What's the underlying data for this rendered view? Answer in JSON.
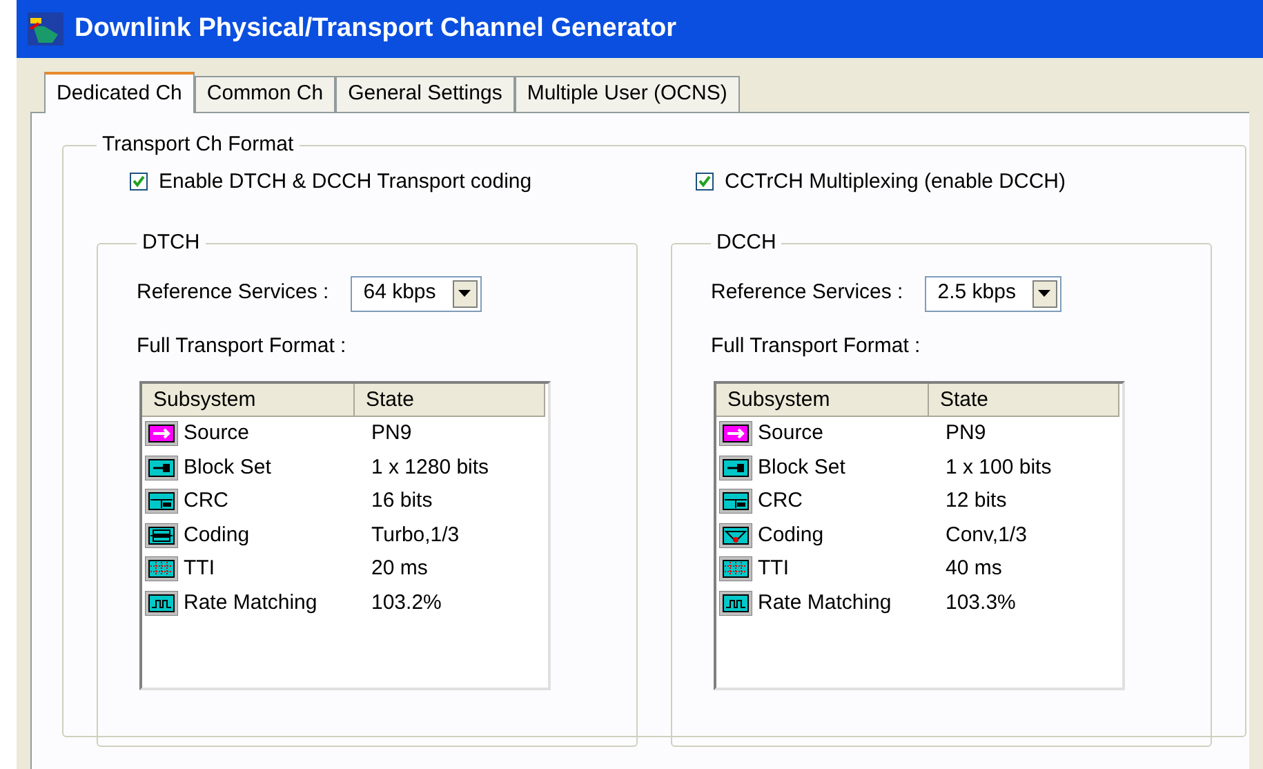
{
  "window": {
    "title": "Downlink Physical/Transport Channel Generator"
  },
  "tabs": [
    {
      "label": "Dedicated Ch",
      "selected": true
    },
    {
      "label": "Common Ch",
      "selected": false
    },
    {
      "label": "General Settings",
      "selected": false
    },
    {
      "label": "Multiple User (OCNS)",
      "selected": false
    }
  ],
  "transport_ch_format": {
    "title": "Transport Ch Format",
    "checkboxes": [
      {
        "label": "Enable DTCH & DCCH Transport coding",
        "checked": true
      },
      {
        "label": "CCTrCH Multiplexing (enable DCCH)",
        "checked": true
      }
    ],
    "groups": [
      {
        "title": "DTCH",
        "reference_label": "Reference Services :",
        "reference_value": "64 kbps",
        "format_label": "Full Transport Format :",
        "columns": [
          "Subsystem",
          "State"
        ],
        "rows": [
          {
            "kind": "source",
            "subsystem": "Source",
            "state": "PN9"
          },
          {
            "kind": "blockset",
            "subsystem": "Block Set",
            "state": "1 x 1280 bits"
          },
          {
            "kind": "crc",
            "subsystem": "CRC",
            "state": "16 bits"
          },
          {
            "kind": "turbo",
            "subsystem": "Coding",
            "state": "Turbo,1/3"
          },
          {
            "kind": "tti",
            "subsystem": "TTI",
            "state": "20 ms"
          },
          {
            "kind": "ratematch",
            "subsystem": "Rate Matching",
            "state": "103.2%"
          }
        ]
      },
      {
        "title": "DCCH",
        "reference_label": "Reference Services :",
        "reference_value": "2.5 kbps",
        "format_label": "Full Transport Format :",
        "columns": [
          "Subsystem",
          "State"
        ],
        "rows": [
          {
            "kind": "source",
            "subsystem": "Source",
            "state": "PN9"
          },
          {
            "kind": "blockset",
            "subsystem": "Block Set",
            "state": "1 x 100 bits"
          },
          {
            "kind": "crc",
            "subsystem": "CRC",
            "state": "12 bits"
          },
          {
            "kind": "conv",
            "subsystem": "Coding",
            "state": "Conv,1/3"
          },
          {
            "kind": "tti",
            "subsystem": "TTI",
            "state": "40 ms"
          },
          {
            "kind": "ratematch",
            "subsystem": "Rate Matching",
            "state": "103.3%"
          }
        ]
      }
    ]
  }
}
